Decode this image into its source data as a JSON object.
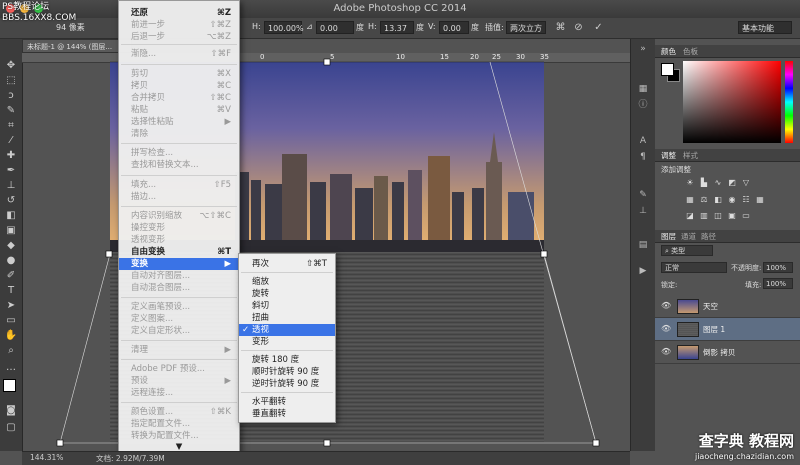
{
  "window": {
    "title": "Adobe Photoshop CC 2014",
    "document_tab": "未标题-1 @ 144% (图层..."
  },
  "options_bar": {
    "w_value": "94 像素",
    "h_label": "H:",
    "h_value": "100.00%",
    "angle_value": "0.00",
    "angle_unit": "度",
    "h_skew_label": "H:",
    "h_skew_value": "13.37",
    "h_skew_unit": "度",
    "v_skew_label": "V:",
    "v_skew_value": "0.00",
    "v_skew_unit": "度",
    "interp_label": "插值:",
    "interp_value": "两次立方",
    "workspace": "基本功能"
  },
  "ruler": {
    "ticks": [
      "0",
      "5",
      "10",
      "15",
      "20",
      "25",
      "30",
      "35"
    ]
  },
  "edit_menu": {
    "items": [
      {
        "label": "还原",
        "shortcut": "⌘Z",
        "state": "bold"
      },
      {
        "label": "前进一步",
        "shortcut": "⇧⌘Z",
        "state": "disabled"
      },
      {
        "label": "后退一步",
        "shortcut": "⌥⌘Z",
        "state": "disabled"
      },
      {
        "label": "渐隐...",
        "shortcut": "⇧⌘F",
        "state": "disabled"
      },
      {
        "label": "剪切",
        "shortcut": "⌘X",
        "state": "disabled"
      },
      {
        "label": "拷贝",
        "shortcut": "⌘C",
        "state": "disabled"
      },
      {
        "label": "合并拷贝",
        "shortcut": "⇧⌘C",
        "state": "disabled"
      },
      {
        "label": "粘贴",
        "shortcut": "⌘V",
        "state": "disabled"
      },
      {
        "label": "选择性粘贴",
        "shortcut": "▶",
        "state": "disabled"
      },
      {
        "label": "清除",
        "shortcut": "",
        "state": "disabled"
      },
      {
        "label": "拼写检查...",
        "shortcut": "",
        "state": "disabled"
      },
      {
        "label": "查找和替换文本...",
        "shortcut": "",
        "state": "disabled"
      },
      {
        "label": "填充...",
        "shortcut": "⇧F5",
        "state": "disabled"
      },
      {
        "label": "描边...",
        "shortcut": "",
        "state": "disabled"
      },
      {
        "label": "内容识别缩放",
        "shortcut": "⌥⇧⌘C",
        "state": "disabled"
      },
      {
        "label": "操控变形",
        "shortcut": "",
        "state": "disabled"
      },
      {
        "label": "透视变形",
        "shortcut": "",
        "state": "disabled"
      },
      {
        "label": "自由变换",
        "shortcut": "⌘T",
        "state": "bold"
      },
      {
        "label": "变换",
        "shortcut": "▶",
        "state": "highlighted"
      },
      {
        "label": "自动对齐图层...",
        "shortcut": "",
        "state": "disabled"
      },
      {
        "label": "自动混合图层...",
        "shortcut": "",
        "state": "disabled"
      },
      {
        "label": "定义画笔预设...",
        "shortcut": "",
        "state": "disabled"
      },
      {
        "label": "定义图案...",
        "shortcut": "",
        "state": "disabled"
      },
      {
        "label": "定义自定形状...",
        "shortcut": "",
        "state": "disabled"
      },
      {
        "label": "清理",
        "shortcut": "▶",
        "state": "disabled"
      },
      {
        "label": "Adobe PDF 预设...",
        "shortcut": "",
        "state": "disabled"
      },
      {
        "label": "预设",
        "shortcut": "▶",
        "state": "disabled"
      },
      {
        "label": "远程连接...",
        "shortcut": "",
        "state": "disabled"
      },
      {
        "label": "颜色设置...",
        "shortcut": "⇧⌘K",
        "state": "disabled"
      },
      {
        "label": "指定配置文件...",
        "shortcut": "",
        "state": "disabled"
      },
      {
        "label": "转换为配置文件...",
        "shortcut": "",
        "state": "disabled"
      }
    ],
    "more_arrow": "▼"
  },
  "transform_submenu": {
    "items": [
      {
        "label": "再次",
        "shortcut": "⇧⌘T",
        "check": ""
      },
      {
        "label": "缩放",
        "shortcut": "",
        "check": ""
      },
      {
        "label": "旋转",
        "shortcut": "",
        "check": ""
      },
      {
        "label": "斜切",
        "shortcut": "",
        "check": ""
      },
      {
        "label": "扭曲",
        "shortcut": "",
        "check": ""
      },
      {
        "label": "透视",
        "shortcut": "",
        "check": "✓"
      },
      {
        "label": "变形",
        "shortcut": "",
        "check": ""
      },
      {
        "label": "旋转 180 度",
        "shortcut": "",
        "check": ""
      },
      {
        "label": "顺时针旋转 90 度",
        "shortcut": "",
        "check": ""
      },
      {
        "label": "逆时针旋转 90 度",
        "shortcut": "",
        "check": ""
      },
      {
        "label": "水平翻转",
        "shortcut": "",
        "check": ""
      },
      {
        "label": "垂直翻转",
        "shortcut": "",
        "check": ""
      }
    ]
  },
  "panels": {
    "color_tabs": [
      "颜色",
      "色板"
    ],
    "adjust_tabs": [
      "调整",
      "样式"
    ],
    "adjust_title": "添加调整",
    "layers_tabs": [
      "图层",
      "通道",
      "路径"
    ],
    "kind_label": "类型",
    "blend_mode": "正常",
    "opacity_label": "不透明度:",
    "opacity_value": "100%",
    "lock_label": "锁定:",
    "fill_label": "填充:",
    "fill_value": "100%",
    "layers": [
      {
        "name": "天空",
        "selected": false
      },
      {
        "name": "图层 1",
        "selected": true
      },
      {
        "name": "倒影 拷贝",
        "selected": false
      }
    ]
  },
  "status_bar": {
    "zoom": "144.31%",
    "doc_info": "文档: 2.92M/7.39M"
  },
  "watermark": {
    "top": "查字典 教程网",
    "bottom": "jiaocheng.chazidian.com",
    "corner_line1": "PS教程论坛",
    "corner_line2": "BBS.16XX8.COM"
  },
  "colors": {
    "accent": "#3a73e6",
    "selected_layer": "#5e6e84"
  }
}
